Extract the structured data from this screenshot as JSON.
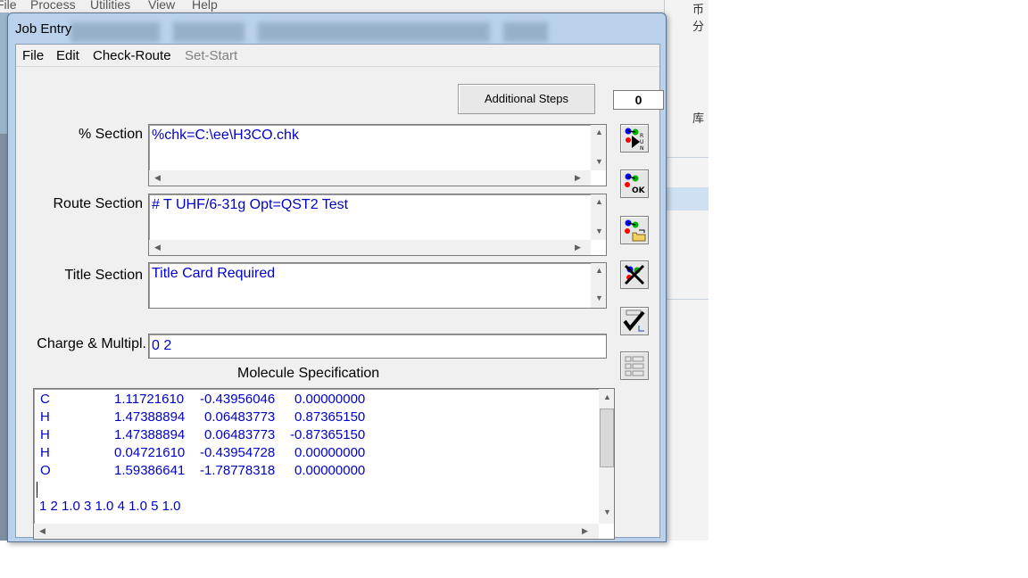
{
  "background": {
    "menu": [
      "File",
      "Process",
      "Utilities",
      "View",
      "Help"
    ],
    "right_text_1": "币分",
    "right_text_2": "库"
  },
  "window": {
    "title": "Job Entry"
  },
  "menu": {
    "file": "File",
    "edit": "Edit",
    "check_route": "Check-Route",
    "set_start": "Set-Start"
  },
  "additional_steps": {
    "label": "Additional Steps",
    "count": "0"
  },
  "sections": {
    "percent_label": "% Section",
    "percent_value": "%chk=C:\\ee\\H3CO.chk",
    "route_label": "Route Section",
    "route_value": "# T UHF/6-31g Opt=QST2 Test",
    "title_label": "Title Section",
    "title_value": "Title Card Required",
    "charge_label": "Charge & Multipl.",
    "charge_value": "0 2"
  },
  "molecule": {
    "heading": "Molecule Specification",
    "atoms": [
      {
        "element": "C",
        "x": "1.11721610",
        "y": "-0.43956046",
        "z": "0.00000000"
      },
      {
        "element": "H",
        "x": "1.47388894",
        "y": "0.06483773",
        "z": "0.87365150"
      },
      {
        "element": "H",
        "x": "1.47388894",
        "y": "0.06483773",
        "z": "-0.87365150"
      },
      {
        "element": "H",
        "x": "0.04721610",
        "y": "-0.43954728",
        "z": "0.00000000"
      },
      {
        "element": "O",
        "x": "1.59386641",
        "y": "-1.78778318",
        "z": "0.00000000"
      }
    ],
    "connectivity": "1 2 1.0 3 1.0 4 1.0 5 1.0"
  },
  "toolbar_icons": [
    "run-icon",
    "ok-icon",
    "open-file-icon",
    "cancel-icon",
    "checkmark-edit-icon",
    "list-icon"
  ]
}
